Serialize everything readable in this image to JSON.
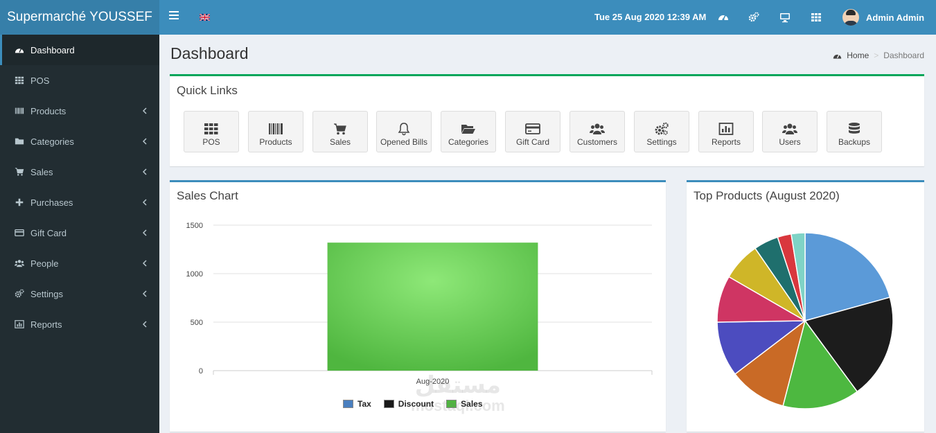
{
  "header": {
    "brand": "Supermarché YOUSSEF",
    "datetime": "Tue 25 Aug 2020 12:39 AM",
    "user": "Admin Admin",
    "icons": [
      "menu-icon",
      "flag-uk-icon",
      "dashboard-icon",
      "cogs-icon",
      "desktop-icon",
      "grid-icon",
      "avatar"
    ]
  },
  "sidebar": {
    "items": [
      {
        "label": "Dashboard",
        "icon": "dashboard-icon"
      },
      {
        "label": "POS",
        "icon": "grid-icon"
      },
      {
        "label": "Products",
        "icon": "barcode-icon"
      },
      {
        "label": "Categories",
        "icon": "folder-icon"
      },
      {
        "label": "Sales",
        "icon": "cart-icon"
      },
      {
        "label": "Purchases",
        "icon": "plus-icon"
      },
      {
        "label": "Gift Card",
        "icon": "credit-card-icon"
      },
      {
        "label": "People",
        "icon": "users-icon"
      },
      {
        "label": "Settings",
        "icon": "cogs-icon"
      },
      {
        "label": "Reports",
        "icon": "bar-chart-icon"
      }
    ]
  },
  "page": {
    "title": "Dashboard",
    "breadcrumb": {
      "home": "Home",
      "current": "Dashboard"
    }
  },
  "quick_links": {
    "title": "Quick Links",
    "items": [
      {
        "label": "POS",
        "icon": "grid-icon"
      },
      {
        "label": "Products",
        "icon": "barcode-icon"
      },
      {
        "label": "Sales",
        "icon": "cart-icon"
      },
      {
        "label": "Opened Bills",
        "icon": "bell-icon"
      },
      {
        "label": "Categories",
        "icon": "folder-open-icon"
      },
      {
        "label": "Gift Card",
        "icon": "credit-card-icon"
      },
      {
        "label": "Customers",
        "icon": "users-icon"
      },
      {
        "label": "Settings",
        "icon": "cogs-icon"
      },
      {
        "label": "Reports",
        "icon": "bar-chart-icon"
      },
      {
        "label": "Users",
        "icon": "users-icon"
      },
      {
        "label": "Backups",
        "icon": "database-icon"
      }
    ]
  },
  "sales_chart": {
    "title": "Sales Chart"
  },
  "top_products": {
    "title": "Top Products (August 2020)"
  },
  "watermark": {
    "line1": "مستقل",
    "line2": "mostaql.com"
  },
  "colors": {
    "brand": "#367fa9",
    "topbar": "#3c8dbc",
    "sidebar": "#222d32",
    "success": "#00a65a"
  },
  "chart_data": [
    {
      "type": "bar",
      "categories": [
        "Aug-2020"
      ],
      "series": [
        {
          "name": "Tax",
          "values": [
            0
          ],
          "color": "#4a7fbf"
        },
        {
          "name": "Discount",
          "values": [
            0
          ],
          "color": "#1a1a1a"
        },
        {
          "name": "Sales",
          "values": [
            1320
          ],
          "color": "#4fb63f"
        }
      ],
      "yticks": [
        0,
        500,
        1000,
        1500
      ],
      "ylim": [
        0,
        1500
      ],
      "legend": "bottom"
    },
    {
      "type": "pie",
      "slices": [
        {
          "value": 20.5,
          "color": "#5b9ad8"
        },
        {
          "value": 19.0,
          "color": "#1c1c1c"
        },
        {
          "value": 14.0,
          "color": "#4db840"
        },
        {
          "value": 10.5,
          "color": "#c96a26"
        },
        {
          "value": 10.0,
          "color": "#4c4cbf"
        },
        {
          "value": 8.5,
          "color": "#cf3563"
        },
        {
          "value": 7.0,
          "color": "#cfb628"
        },
        {
          "value": 4.5,
          "color": "#1f6f6d"
        },
        {
          "value": 2.5,
          "color": "#d9373d"
        },
        {
          "value": 2.5,
          "color": "#7fd3c6"
        }
      ],
      "legend": "none"
    }
  ]
}
